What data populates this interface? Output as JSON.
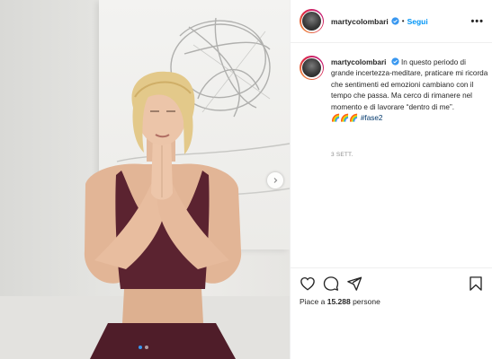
{
  "post": {
    "username": "martycolombari",
    "follow_label": "Segui",
    "bullet": "•",
    "more_label": "•••",
    "caption": {
      "username": "martycolombari",
      "text": "In questo periodo di grande incertezza-meditare, praticare mi ricorda che sentimenti ed emozioni cambiano con il tempo che passa. Ma cerco di rimanere nel momento e di lavorare “dentro di me”.",
      "emoji": "🌈🌈🌈",
      "hashtag": "#fase2",
      "time": "3 SETT."
    },
    "likes": {
      "prefix": "Piace a ",
      "count": "15.288",
      "suffix": " persone"
    },
    "carousel": {
      "total": 2,
      "active": 0
    }
  },
  "icons": [
    "verified-badge-icon",
    "heart-icon",
    "comment-icon",
    "share-icon",
    "bookmark-icon",
    "chevron-right-icon"
  ],
  "colors": {
    "link": "#0095f6",
    "verified": "#3897f0",
    "muted": "#8e8e8e",
    "outfit": "#5b2330"
  }
}
